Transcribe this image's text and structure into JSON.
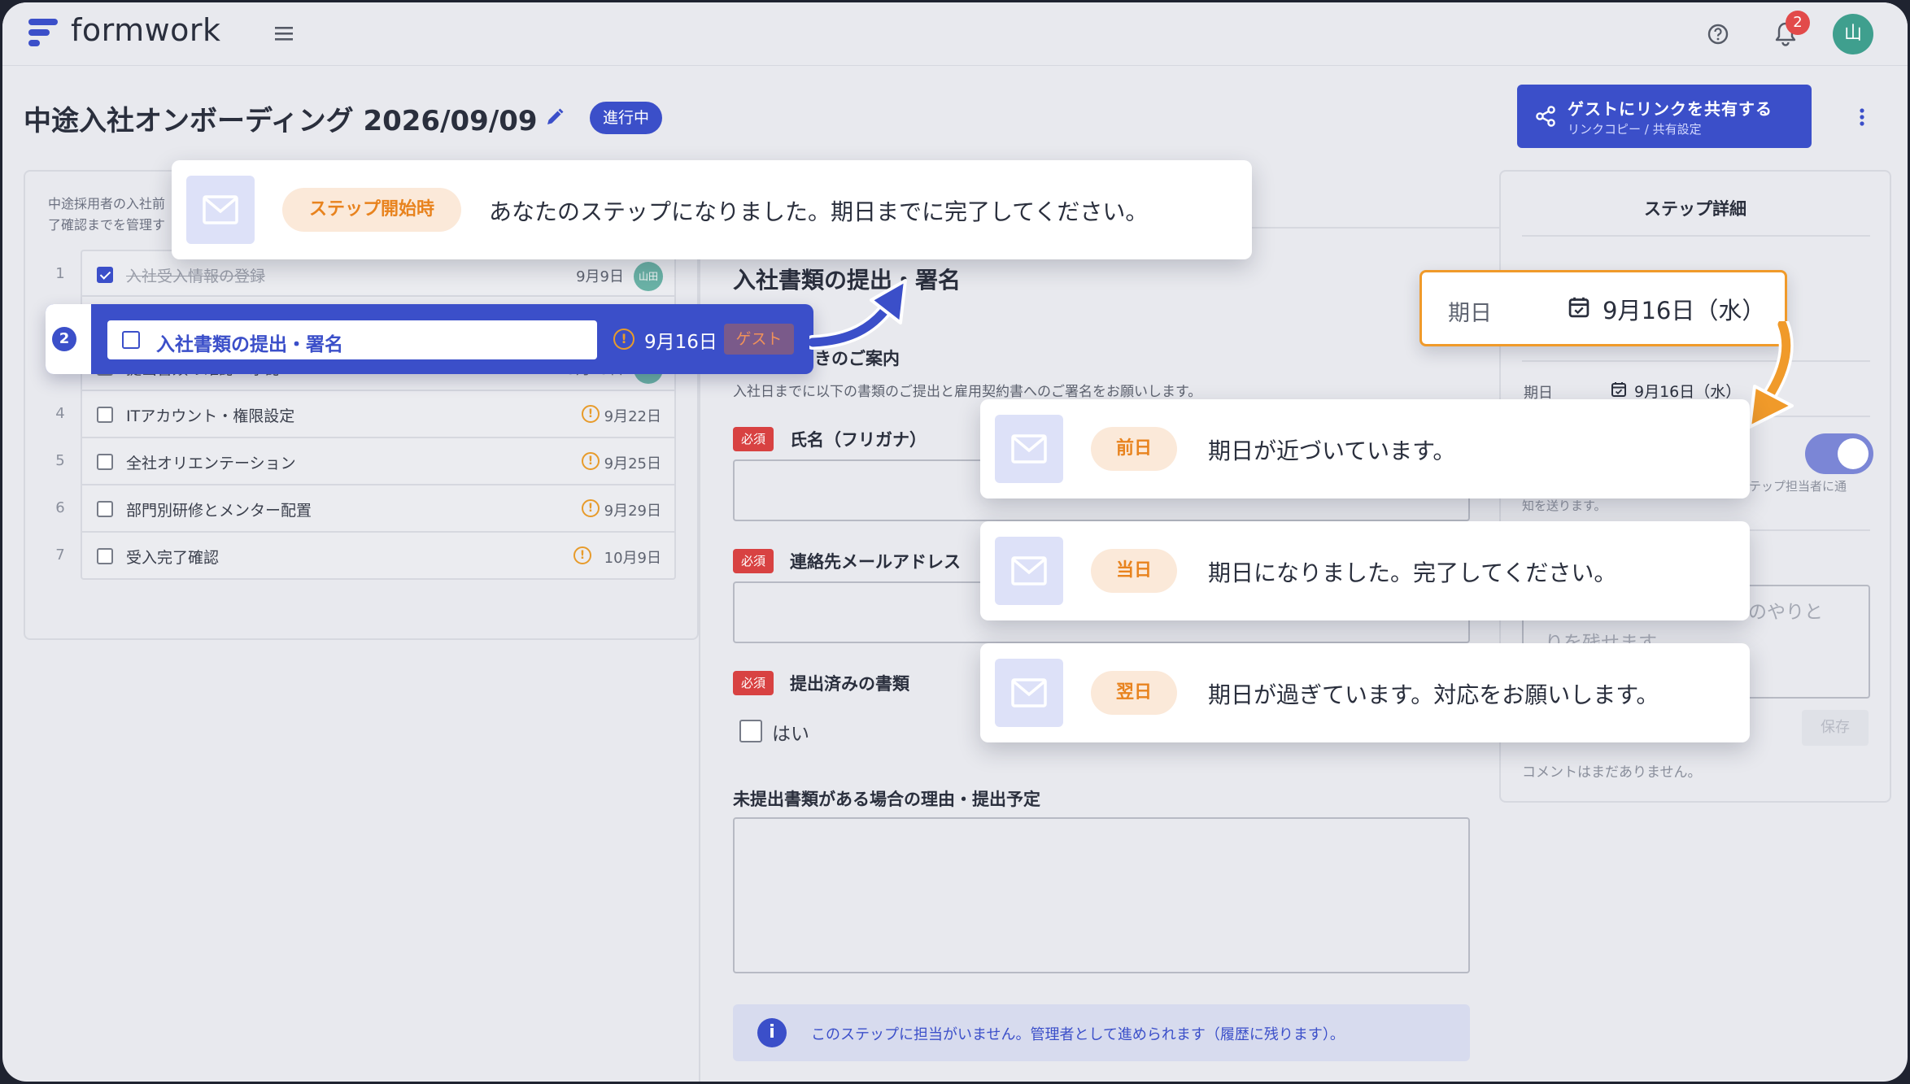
{
  "app": {
    "name": "formwork",
    "notification_count": "2",
    "user_avatar": "山"
  },
  "page": {
    "title": "中途入社オンボーディング 2026/09/09",
    "status": "進行中"
  },
  "share": {
    "title": "ゲストにリンクを共有する",
    "subtitle": "リンクコピー / 共有設定"
  },
  "left": {
    "desc_line1": "中途採用者の入社前",
    "desc_line2": "了確認までを管理す",
    "steps": [
      {
        "num": "1",
        "label": "入社受入情報の登録",
        "date": "9月9日",
        "avatar": "山田",
        "done": true
      },
      {
        "num": "2",
        "label": "入社書類の提出・署名",
        "date": "9月16日",
        "tag": "ゲスト"
      },
      {
        "num": "3",
        "label": "提出書類の確認・承認",
        "date": "9月19日",
        "avatar": "山田"
      },
      {
        "num": "4",
        "label": "ITアカウント・権限設定",
        "date": "9月22日"
      },
      {
        "num": "5",
        "label": "全社オリエンテーション",
        "date": "9月25日"
      },
      {
        "num": "6",
        "label": "部門別研修とメンター配置",
        "date": "9月29日"
      },
      {
        "num": "7",
        "label": "受入完了確認",
        "date": "10月9日"
      }
    ]
  },
  "form": {
    "title": "入社書類の提出・署名",
    "section_heading": "きのご案内",
    "section_desc": "入社日までに以下の書類のご提出と雇用契約書へのご署名をお願いします。",
    "required": "必須",
    "field_name": "氏名（フリガナ）",
    "field_email": "連絡先メールアドレス",
    "field_docs": "提出済みの書類",
    "yes": "はい",
    "reason_label": "未提出書類がある場合の理由・提出予定",
    "info": "このステップに担当がいません。管理者として進められます（履歴に残ります）。"
  },
  "details": {
    "title": "ステップ詳細",
    "due_label": "期日",
    "due_value": "9月16日（水）",
    "note1": "ステップ担当者に通",
    "note2": "知を送ります。",
    "comment_ph1": "のやりと",
    "comment_ph2": "りを残せます",
    "save": "保存",
    "no_comments": "コメントはまだありません。"
  },
  "notifications": [
    {
      "timing": "ステップ開始時",
      "message": "あなたのステップになりました。期日までに完了してください。"
    },
    {
      "timing": "前日",
      "message": "期日が近づいています。"
    },
    {
      "timing": "当日",
      "message": "期日になりました。完了してください。"
    },
    {
      "timing": "翌日",
      "message": "期日が過ぎています。対応をお願いします。"
    }
  ],
  "due_popup": {
    "label": "期日",
    "value": "9月16日（水）"
  },
  "colors": {
    "primary": "#3b4fc9",
    "accent": "#f09a2a",
    "required": "#d84242",
    "avatar": "#3f9f8e"
  }
}
